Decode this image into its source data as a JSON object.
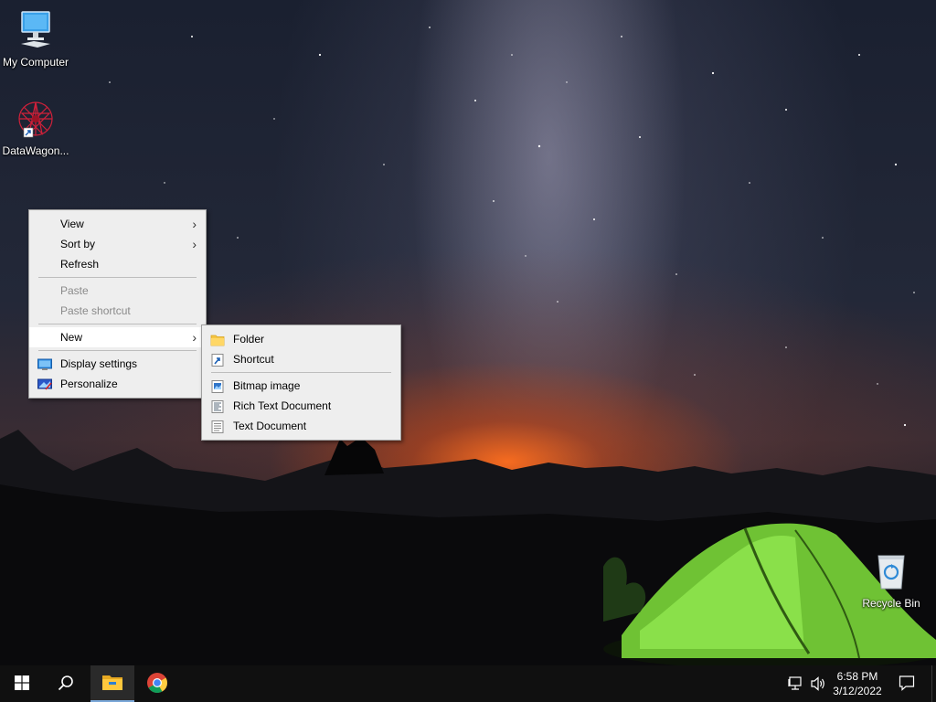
{
  "desktop": {
    "icons": [
      {
        "label": "My Computer",
        "icon": "monitor-icon"
      },
      {
        "label": "DataWagon...",
        "icon": "datawagon-shortcut-icon"
      },
      {
        "label": "Recycle Bin",
        "icon": "recycle-bin-icon"
      }
    ]
  },
  "context_menu": {
    "items": [
      {
        "label": "View",
        "submenu": true
      },
      {
        "label": "Sort by",
        "submenu": true
      },
      {
        "label": "Refresh"
      },
      {
        "label": "Paste",
        "disabled": true
      },
      {
        "label": "Paste shortcut",
        "disabled": true
      },
      {
        "label": "New",
        "submenu": true,
        "highlighted": true
      },
      {
        "label": "Display settings",
        "icon": "display-settings-icon"
      },
      {
        "label": "Personalize",
        "icon": "personalize-icon"
      }
    ]
  },
  "new_submenu": {
    "items": [
      {
        "label": "Folder",
        "icon": "folder-icon"
      },
      {
        "label": "Shortcut",
        "icon": "shortcut-icon"
      },
      {
        "label": "Bitmap image",
        "icon": "bitmap-icon"
      },
      {
        "label": "Rich Text Document",
        "icon": "rich-text-icon"
      },
      {
        "label": "Text Document",
        "icon": "text-document-icon"
      }
    ]
  },
  "taskbar": {
    "apps": [
      {
        "name": "start",
        "icon": "windows-start-icon"
      },
      {
        "name": "search",
        "icon": "search-icon"
      },
      {
        "name": "file-explorer",
        "icon": "file-explorer-icon",
        "active": true
      },
      {
        "name": "chrome",
        "icon": "chrome-icon"
      }
    ],
    "tray": {
      "network_icon": "network-icon",
      "volume_icon": "volume-icon",
      "notification_icon": "notification-icon"
    },
    "clock": {
      "time": "6:58 PM",
      "date": "3/12/2022"
    }
  },
  "colors": {
    "menu_bg": "#eeeeee",
    "menu_highlight": "#ffffff",
    "taskbar_bg": "#101010",
    "tent_green": "#7cd13a",
    "sunset_orange": "#ff6a1e"
  }
}
